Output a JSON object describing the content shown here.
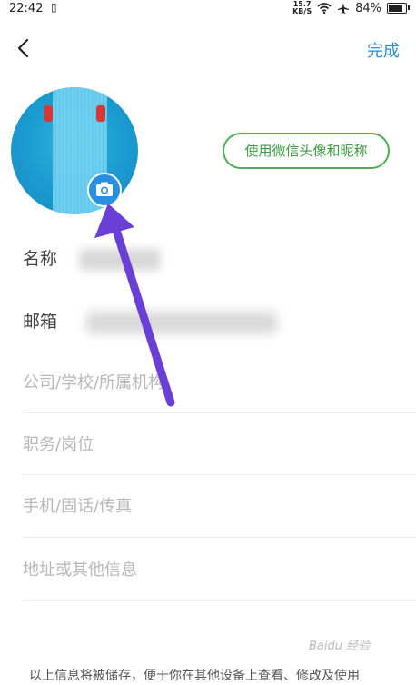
{
  "status_bar": {
    "time": "22:42",
    "net_speed_value": "15.7",
    "net_speed_unit": "KB/S",
    "battery": "84%",
    "battery_level": 0.84
  },
  "header": {
    "back_icon": "chevron-left-icon",
    "done_label": "完成"
  },
  "avatar": {
    "camera_icon": "camera-icon"
  },
  "wechat_button_label": "使用微信头像和昵称",
  "fields": {
    "name_label": "名称",
    "email_label": "邮箱",
    "company_placeholder": "公司/学校/所属机构",
    "position_placeholder": "职务/岗位",
    "phone_placeholder": "手机/固话/传真",
    "address_placeholder": "地址或其他信息"
  },
  "footer_note": "以上信息将被储存，便于你在其他设备上查看、修改及使用",
  "watermark": "Baidu 经验",
  "colors": {
    "accent": "#2f8ed8",
    "wechat_green": "#4caf50",
    "annotation_arrow": "#6a3fd6"
  }
}
